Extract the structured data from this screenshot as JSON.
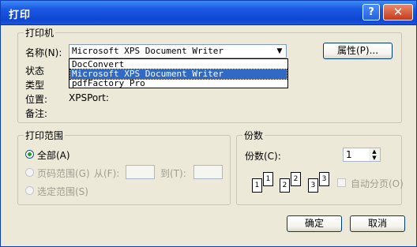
{
  "window": {
    "title": "打印",
    "help_label": "?",
    "close_label": "✕"
  },
  "printer": {
    "group_title": "打印机",
    "name_label": "名称(N):",
    "selected": "Microsoft XPS Document Writer",
    "options": [
      "DocConvert",
      "Microsoft XPS Document Writer",
      "pdfFactory Pro"
    ],
    "status_label": "状态",
    "type_label": "类型",
    "location_label": "位置:",
    "location_value": "XPSPort:",
    "comment_label": "备注:",
    "properties_label": "属性(P)..."
  },
  "range": {
    "group_title": "打印范围",
    "all_label": "全部(A)",
    "pages_label": "页码范围(G)",
    "from_label": "从(F):",
    "to_label": "到(T):",
    "selection_label": "选定范围(S)"
  },
  "copies": {
    "group_title": "份数",
    "count_label": "份数(C):",
    "count_value": "1",
    "collate_label": "自动分页(O)"
  },
  "buttons": {
    "ok": "确定",
    "cancel": "取消"
  },
  "icons": {
    "dropdown": "chevron-down-icon",
    "spinner": "spin-arrows-icon"
  }
}
